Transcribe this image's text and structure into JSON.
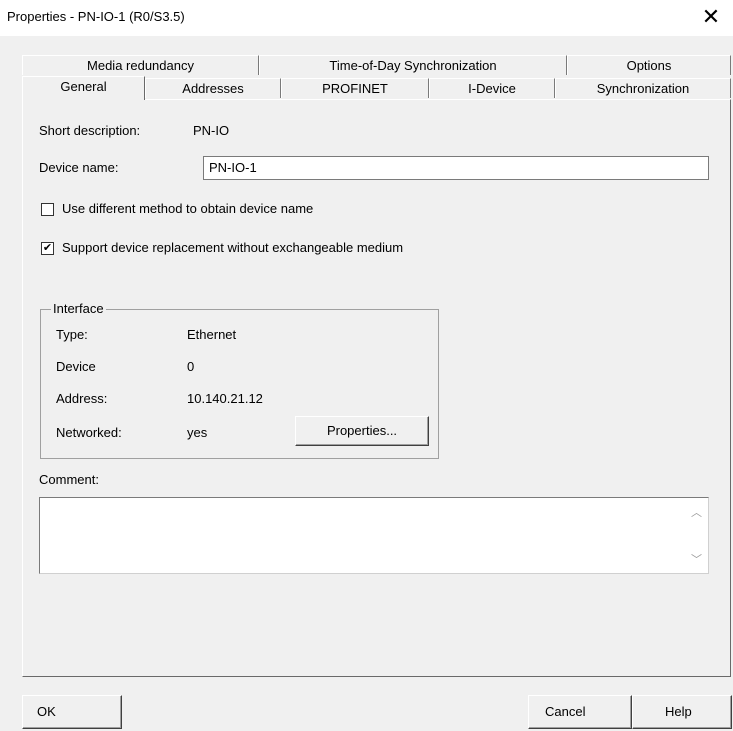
{
  "window": {
    "title": "Properties - PN-IO-1 (R0/S3.5)",
    "close_glyph": "✕"
  },
  "tabs_back": [
    "Media redundancy",
    "Time-of-Day Synchronization",
    "Options"
  ],
  "tabs_front": [
    "General",
    "Addresses",
    "PROFINET",
    "I-Device",
    "Synchronization"
  ],
  "active_tab": "General",
  "general": {
    "short_description_label": "Short description:",
    "short_description_value": "PN-IO",
    "device_name_label": "Device name:",
    "device_name_value": "PN-IO-1",
    "checkbox_different_method": {
      "label": "Use different method to obtain device name",
      "checked": false
    },
    "checkbox_support_replacement": {
      "label": "Support device replacement without exchangeable medium",
      "checked": true
    }
  },
  "interface": {
    "title": "Interface",
    "type_label": "Type:",
    "type_value": "Ethernet",
    "device_label": "Device",
    "device_value": "0",
    "address_label": "Address:",
    "address_value": "10.140.21.12",
    "networked_label": "Networked:",
    "networked_value": "yes",
    "properties_button": "Properties..."
  },
  "comment": {
    "label": "Comment:",
    "value": ""
  },
  "footer": {
    "ok": "OK",
    "cancel": "Cancel",
    "help": "Help"
  }
}
